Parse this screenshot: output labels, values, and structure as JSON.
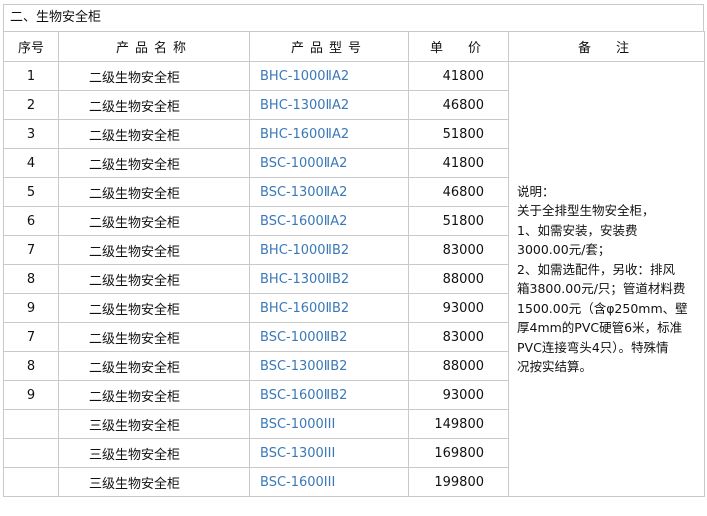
{
  "section_title": "二、生物安全柜",
  "headers": {
    "seq": "序号",
    "name": "产品名称",
    "model": "产品型号",
    "price": "单　价",
    "note": "备　注"
  },
  "rows": [
    {
      "seq": "1",
      "name": "二级生物安全柜",
      "model": "BHC-1000ⅡA2",
      "price": "41800"
    },
    {
      "seq": "2",
      "name": "二级生物安全柜",
      "model": "BHC-1300ⅡA2",
      "price": "46800"
    },
    {
      "seq": "3",
      "name": "二级生物安全柜",
      "model": "BHC-1600ⅡA2",
      "price": "51800"
    },
    {
      "seq": "4",
      "name": "二级生物安全柜",
      "model": "BSC-1000ⅡA2",
      "price": "41800"
    },
    {
      "seq": "5",
      "name": "二级生物安全柜",
      "model": "BSC-1300ⅡA2",
      "price": "46800"
    },
    {
      "seq": "6",
      "name": "二级生物安全柜",
      "model": "BSC-1600ⅡA2",
      "price": "51800"
    },
    {
      "seq": "7",
      "name": "二级生物安全柜",
      "model": "BHC-1000ⅡB2",
      "price": "83000"
    },
    {
      "seq": "8",
      "name": "二级生物安全柜",
      "model": "BHC-1300ⅡB2",
      "price": "88000"
    },
    {
      "seq": "9",
      "name": "二级生物安全柜",
      "model": "BHC-1600ⅡB2",
      "price": "93000"
    },
    {
      "seq": "7",
      "name": "二级生物安全柜",
      "model": "BSC-1000ⅡB2",
      "price": "83000"
    },
    {
      "seq": "8",
      "name": "二级生物安全柜",
      "model": "BSC-1300ⅡB2",
      "price": "88000"
    },
    {
      "seq": "9",
      "name": "二级生物安全柜",
      "model": "BSC-1600ⅡB2",
      "price": "93000"
    },
    {
      "seq": "",
      "name": "三级生物安全柜",
      "model": "BSC-1000III",
      "price": "149800"
    },
    {
      "seq": "",
      "name": "三级生物安全柜",
      "model": "BSC-1300III",
      "price": "169800"
    },
    {
      "seq": "",
      "name": "三级生物安全柜",
      "model": "BSC-1600III",
      "price": "199800"
    }
  ],
  "note_lines": [
    "说明：",
    "关于全排型生物安全柜，",
    "1、如需安装，安装费",
    "3000.00元/套；",
    "2、如需选配件，另收：排风",
    "箱3800.00元/只；管道材料费",
    "1500.00元（含φ250mm、壁",
    "厚4mm的PVC硬管6米，标准",
    "PVC连接弯头4只）。特殊情",
    "况按实结算。"
  ]
}
